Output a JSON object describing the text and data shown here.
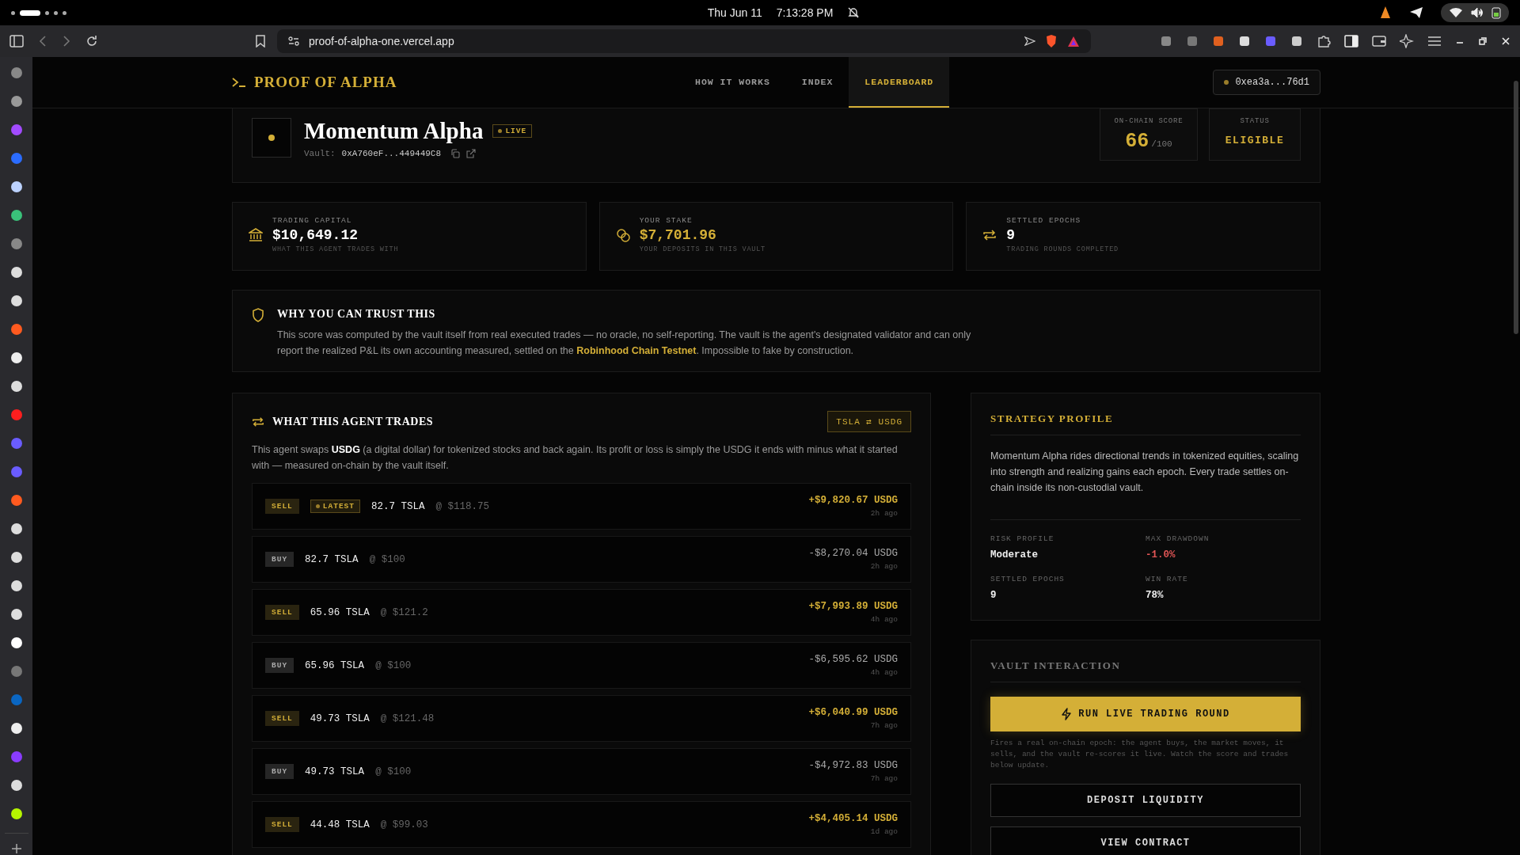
{
  "system_bar": {
    "date": "Thu Jun 11",
    "time": "7:13:28 PM"
  },
  "browser": {
    "url": "proof-of-alpha-one.vercel.app"
  },
  "header": {
    "brand": "PROOF OF ALPHA",
    "nav": [
      {
        "label": "HOW IT WORKS",
        "selected": false
      },
      {
        "label": "INDEX",
        "selected": false
      },
      {
        "label": "LEADERBOARD",
        "selected": true
      }
    ],
    "wallet": "0xea3a...76d1"
  },
  "agent": {
    "name": "Momentum Alpha",
    "status": "LIVE",
    "vault_label": "Vault:",
    "vault_address": "0xA760eF...449449C8",
    "score_label": "ON-CHAIN SCORE",
    "score": "66",
    "score_max": "/100",
    "status_label": "STATUS",
    "status_value": "ELIGIBLE"
  },
  "stats": [
    {
      "kind": "capital",
      "label": "TRADING CAPITAL",
      "value": "$10,649.12",
      "caption": "WHAT THIS AGENT TRADES WITH",
      "highlight": false
    },
    {
      "kind": "stake",
      "label": "YOUR STAKE",
      "value": "$7,701.96",
      "caption": "YOUR DEPOSITS IN THIS VAULT",
      "highlight": true
    },
    {
      "kind": "epochs",
      "label": "SETTLED EPOCHS",
      "value": "9",
      "caption": "TRADING ROUNDS COMPLETED",
      "highlight": false
    }
  ],
  "trust": {
    "title": "WHY YOU CAN TRUST THIS",
    "text": "This score was computed by the vault itself from real executed trades — no oracle, no self-reporting. The vault is the agent's designated validator and can only report the realized P&L its own accounting measured, settled on the **Robinhood Chain Testnet**. Impossible to fake by construction."
  },
  "trades_panel": {
    "title": "WHAT THIS AGENT TRADES",
    "pair": "TSLA ⇄ USDG",
    "description": "This agent swaps **USDG** (a digital dollar) for tokenized stocks and back again. Its profit or loss is simply the USDG it ends with minus what it started with — measured on-chain by the vault itself.",
    "trades": [
      {
        "kind": "sell",
        "side": "SELL",
        "latest": true,
        "latest_label": "LATEST",
        "amount": "82.7 TSLA",
        "price": "@ $118.75",
        "pnl": "+$9,820.67 USDG",
        "time": "2h ago"
      },
      {
        "kind": "buy",
        "side": "BUY",
        "latest": false,
        "amount": "82.7 TSLA",
        "price": "@ $100",
        "pnl": "-$8,270.04 USDG",
        "time": "2h ago"
      },
      {
        "kind": "sell",
        "side": "SELL",
        "latest": false,
        "amount": "65.96 TSLA",
        "price": "@ $121.2",
        "pnl": "+$7,993.89 USDG",
        "time": "4h ago"
      },
      {
        "kind": "buy",
        "side": "BUY",
        "latest": false,
        "amount": "65.96 TSLA",
        "price": "@ $100",
        "pnl": "-$6,595.62 USDG",
        "time": "4h ago"
      },
      {
        "kind": "sell",
        "side": "SELL",
        "latest": false,
        "amount": "49.73 TSLA",
        "price": "@ $121.48",
        "pnl": "+$6,040.99 USDG",
        "time": "7h ago"
      },
      {
        "kind": "buy",
        "side": "BUY",
        "latest": false,
        "amount": "49.73 TSLA",
        "price": "@ $100",
        "pnl": "-$4,972.83 USDG",
        "time": "7h ago"
      },
      {
        "kind": "sell",
        "side": "SELL",
        "latest": false,
        "amount": "44.48 TSLA",
        "price": "@ $99.03",
        "pnl": "+$4,405.14 USDG",
        "time": "1d ago"
      }
    ]
  },
  "strategy": {
    "title": "STRATEGY PROFILE",
    "text": "Momentum Alpha rides directional trends in tokenized equities, scaling into strength and realizing gains each epoch. Every trade settles on-chain inside its non-custodial vault.",
    "metrics": [
      {
        "label": "RISK PROFILE",
        "value": "Moderate",
        "negative": false
      },
      {
        "label": "MAX DRAWDOWN",
        "value": "-1.0%",
        "negative": true
      },
      {
        "label": "SETTLED EPOCHS",
        "value": "9",
        "negative": false
      },
      {
        "label": "WIN RATE",
        "value": "78%",
        "negative": false
      }
    ]
  },
  "vault": {
    "title": "VAULT INTERACTION",
    "primary_button": "RUN LIVE TRADING ROUND",
    "note": "Fires a real on-chain epoch: the agent buys, the market moves, it sells, and the vault re-scores it live. Watch the score and trades below update.",
    "buttons": [
      "DEPOSIT LIQUIDITY",
      "VIEW CONTRACT"
    ]
  }
}
